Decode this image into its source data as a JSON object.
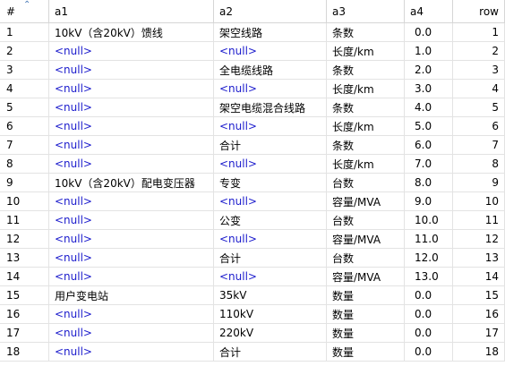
{
  "columns": {
    "idx": "#",
    "a1": "a1",
    "a2": "a2",
    "a3": "a3",
    "a4": "a4",
    "row": "row"
  },
  "sort_icon": "sort-ascending-icon",
  "null_color": "#1b1bcc",
  "rows": [
    {
      "idx": "1",
      "a1": "10kV（含20kV）馈线",
      "a2": "架空线路",
      "a3": "条数",
      "a4": "0.0",
      "row": "1"
    },
    {
      "idx": "2",
      "a1": "<null>",
      "a2": "<null>",
      "a3": "长度/km",
      "a4": "1.0",
      "row": "2"
    },
    {
      "idx": "3",
      "a1": "<null>",
      "a2": "全电缆线路",
      "a3": "条数",
      "a4": "2.0",
      "row": "3"
    },
    {
      "idx": "4",
      "a1": "<null>",
      "a2": "<null>",
      "a3": "长度/km",
      "a4": "3.0",
      "row": "4"
    },
    {
      "idx": "5",
      "a1": "<null>",
      "a2": "架空电缆混合线路",
      "a3": "条数",
      "a4": "4.0",
      "row": "5"
    },
    {
      "idx": "6",
      "a1": "<null>",
      "a2": "<null>",
      "a3": "长度/km",
      "a4": "5.0",
      "row": "6"
    },
    {
      "idx": "7",
      "a1": "<null>",
      "a2": "合计",
      "a3": "条数",
      "a4": "6.0",
      "row": "7"
    },
    {
      "idx": "8",
      "a1": "<null>",
      "a2": "<null>",
      "a3": "长度/km",
      "a4": "7.0",
      "row": "8"
    },
    {
      "idx": "9",
      "a1": "10kV（含20kV）配电变压器",
      "a2": "专变",
      "a3": "台数",
      "a4": "8.0",
      "row": "9"
    },
    {
      "idx": "10",
      "a1": "<null>",
      "a2": "<null>",
      "a3": "容量/MVA",
      "a4": "9.0",
      "row": "10"
    },
    {
      "idx": "11",
      "a1": "<null>",
      "a2": "公变",
      "a3": "台数",
      "a4": "10.0",
      "row": "11"
    },
    {
      "idx": "12",
      "a1": "<null>",
      "a2": "<null>",
      "a3": "容量/MVA",
      "a4": "11.0",
      "row": "12"
    },
    {
      "idx": "13",
      "a1": "<null>",
      "a2": "合计",
      "a3": "台数",
      "a4": "12.0",
      "row": "13"
    },
    {
      "idx": "14",
      "a1": "<null>",
      "a2": "<null>",
      "a3": "容量/MVA",
      "a4": "13.0",
      "row": "14"
    },
    {
      "idx": "15",
      "a1": "用户变电站",
      "a2": "35kV",
      "a3": "数量",
      "a4": "0.0",
      "row": "15"
    },
    {
      "idx": "16",
      "a1": "<null>",
      "a2": "110kV",
      "a3": "数量",
      "a4": "0.0",
      "row": "16"
    },
    {
      "idx": "17",
      "a1": "<null>",
      "a2": "220kV",
      "a3": "数量",
      "a4": "0.0",
      "row": "17"
    },
    {
      "idx": "18",
      "a1": "<null>",
      "a2": "合计",
      "a3": "数量",
      "a4": "0.0",
      "row": "18"
    }
  ]
}
